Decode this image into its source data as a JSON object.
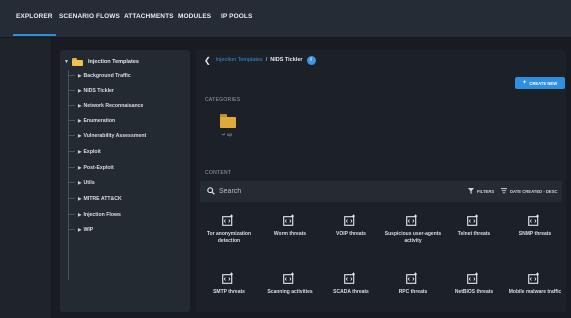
{
  "nav": {
    "tabs": [
      {
        "label": "EXPLORER"
      },
      {
        "label": "SCENARIO FLOWS"
      },
      {
        "label": "ATTACHMENTS"
      },
      {
        "label": "MODULES"
      },
      {
        "label": "IP POOLS"
      }
    ],
    "active_tab": "EXPLORER",
    "accent_color": "#2e8fd8"
  },
  "tree": {
    "root": {
      "label": "Injection Templates",
      "icon": "folder-icon",
      "expanded": true
    },
    "items": [
      {
        "label": "Background Traffic"
      },
      {
        "label": "NIDS Tickler"
      },
      {
        "label": "Network Reconnaisance"
      },
      {
        "label": "Enumeration"
      },
      {
        "label": "Vulnerability Assessment"
      },
      {
        "label": "Exploit"
      },
      {
        "label": "Post-Exploit"
      },
      {
        "label": "Utils"
      },
      {
        "label": "MITRE ATT&CK"
      },
      {
        "label": "Injection Flows"
      },
      {
        "label": "WIP"
      }
    ]
  },
  "breadcrumb": {
    "parent": "Injection Templates",
    "separator": "/",
    "current": "NIDS Tickler",
    "info_icon": "i"
  },
  "create_button": {
    "label": "CREATE NEW",
    "icon": "plus-icon"
  },
  "categories": {
    "label": "CATEGORIES",
    "up_folder": {
      "label": "↵ up",
      "icon": "folder-icon"
    }
  },
  "content": {
    "label": "CONTENT",
    "search_placeholder": "Search",
    "filters_label": "FILTERS",
    "sort_label": "DATE CREATED - DESC",
    "items": [
      {
        "label": "Tor anonymization detection"
      },
      {
        "label": "Worm threats"
      },
      {
        "label": "VOIP threats"
      },
      {
        "label": "Suspicious user-agents activity"
      },
      {
        "label": "Telnet threats"
      },
      {
        "label": "SNMP threats"
      },
      {
        "label": "SMTP threats"
      },
      {
        "label": "Scanning activities"
      },
      {
        "label": "SCADA threats"
      },
      {
        "label": "RPC threats"
      },
      {
        "label": "NetBIOS threats"
      },
      {
        "label": "Mobile malware traffic"
      }
    ],
    "item_icon": "code-file-icon"
  }
}
